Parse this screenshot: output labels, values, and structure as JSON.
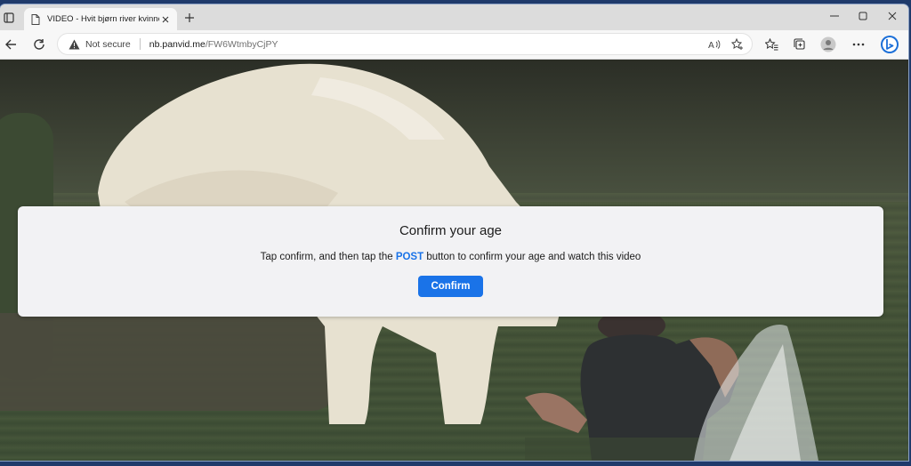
{
  "browser": {
    "tab": {
      "title": "VIDEO - Hvit bjørn river kvinnen"
    },
    "address": {
      "security_label": "Not secure",
      "host": "nb.panvid.me",
      "path": "/FW6WtmbyCjPY"
    }
  },
  "dialog": {
    "title": "Confirm your age",
    "text_before": "Tap confirm, and then tap the ",
    "highlight": "POST",
    "text_after": " button to confirm your age and watch this video",
    "button_label": "Confirm"
  },
  "colors": {
    "accent": "#1a73e8"
  }
}
